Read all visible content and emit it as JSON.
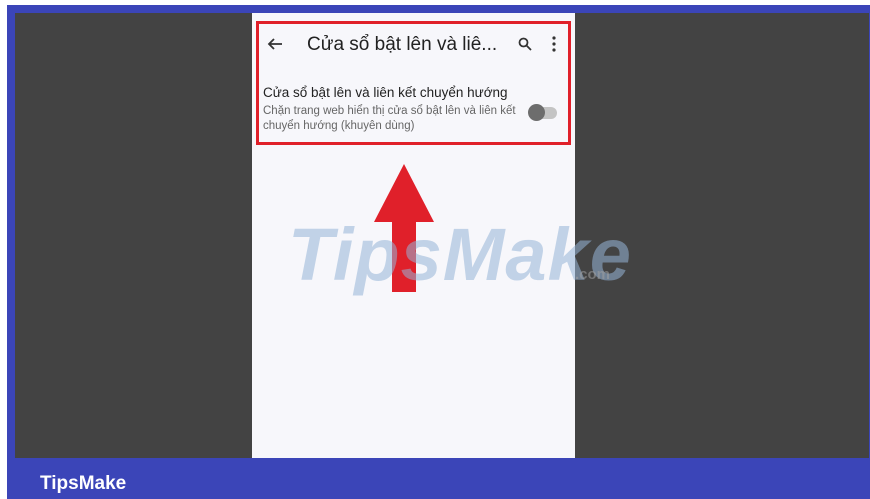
{
  "app_bar": {
    "title": "Cửa sổ bật lên và liê...",
    "icons": [
      "back-arrow-icon",
      "search-icon",
      "more-vert-icon"
    ]
  },
  "setting": {
    "title": "Cửa sổ bật lên và liên kết chuyển hướng",
    "description": "Chặn trang web hiển thị cửa sổ bật lên và liên kết chuyển hướng (khuyên dùng)",
    "toggle_on": false
  },
  "watermark": {
    "text": "TipsMake",
    "suffix": ".com"
  },
  "footer": {
    "brand": "TipsMake"
  },
  "colors": {
    "frame": "#3b45b8",
    "background": "#434343",
    "phone_screen": "#f7f7fb",
    "highlight": "#e0202a",
    "arrow": "#e0202a"
  }
}
